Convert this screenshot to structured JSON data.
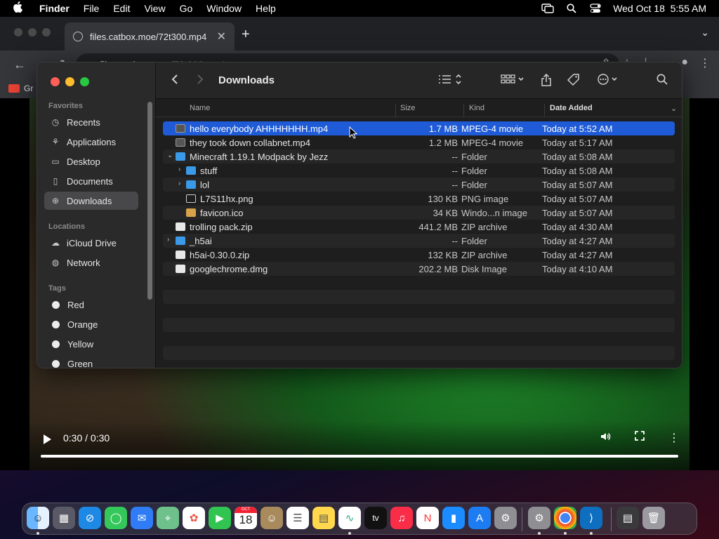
{
  "menubar": {
    "app": "Finder",
    "items": [
      "File",
      "Edit",
      "View",
      "Go",
      "Window",
      "Help"
    ],
    "clock": "Wed Oct 18  5:55 AM"
  },
  "browser": {
    "tab_title": "files.catbox.moe/72t300.mp4",
    "url_host": "files.catbox.moe",
    "url_path": "/72t300.mp4",
    "bookmark_label": "Gr"
  },
  "video": {
    "time": "0:30 / 0:30",
    "progress": 1.0
  },
  "finder": {
    "title": "Downloads",
    "sidebar": {
      "favorites_header": "Favorites",
      "favorites": [
        {
          "label": "Recents",
          "icon": "clock-icon"
        },
        {
          "label": "Applications",
          "icon": "applications-icon"
        },
        {
          "label": "Desktop",
          "icon": "desktop-icon"
        },
        {
          "label": "Documents",
          "icon": "document-icon"
        },
        {
          "label": "Downloads",
          "icon": "download-icon"
        }
      ],
      "locations_header": "Locations",
      "locations": [
        {
          "label": "iCloud Drive",
          "icon": "cloud-icon"
        },
        {
          "label": "Network",
          "icon": "globe-icon"
        }
      ],
      "tags_header": "Tags",
      "tags": [
        "Red",
        "Orange",
        "Yellow",
        "Green"
      ]
    },
    "columns": {
      "name": "Name",
      "size": "Size",
      "kind": "Kind",
      "date": "Date Added"
    },
    "rows": [
      {
        "name": "hello everybody AHHHHHHH.mp4",
        "size": "1.7 MB",
        "kind": "MPEG-4 movie",
        "date": "Today at 5:52 AM"
      },
      {
        "name": "they took down collabnet.mp4",
        "size": "1.2 MB",
        "kind": "MPEG-4 movie",
        "date": "Today at 5:17 AM"
      },
      {
        "name": "Minecraft 1.19.1 Modpack by Jezz",
        "size": "--",
        "kind": "Folder",
        "date": "Today at 5:08 AM"
      },
      {
        "name": "stuff",
        "size": "--",
        "kind": "Folder",
        "date": "Today at 5:08 AM"
      },
      {
        "name": "lol",
        "size": "--",
        "kind": "Folder",
        "date": "Today at 5:07 AM"
      },
      {
        "name": "L7S11hx.png",
        "size": "130 KB",
        "kind": "PNG image",
        "date": "Today at 5:07 AM"
      },
      {
        "name": "favicon.ico",
        "size": "34 KB",
        "kind": "Windo...n image",
        "date": "Today at 5:07 AM"
      },
      {
        "name": "trolling pack.zip",
        "size": "441.2 MB",
        "kind": "ZIP archive",
        "date": "Today at 4:30 AM"
      },
      {
        "name": "_h5ai",
        "size": "--",
        "kind": "Folder",
        "date": "Today at 4:27 AM"
      },
      {
        "name": "h5ai-0.30.0.zip",
        "size": "132 KB",
        "kind": "ZIP archive",
        "date": "Today at 4:27 AM"
      },
      {
        "name": "googlechrome.dmg",
        "size": "202.2 MB",
        "kind": "Disk Image",
        "date": "Today at 4:10 AM"
      }
    ]
  },
  "dock": {
    "calendar_month": "OCT",
    "calendar_day": "18",
    "tv_label": "tv"
  }
}
